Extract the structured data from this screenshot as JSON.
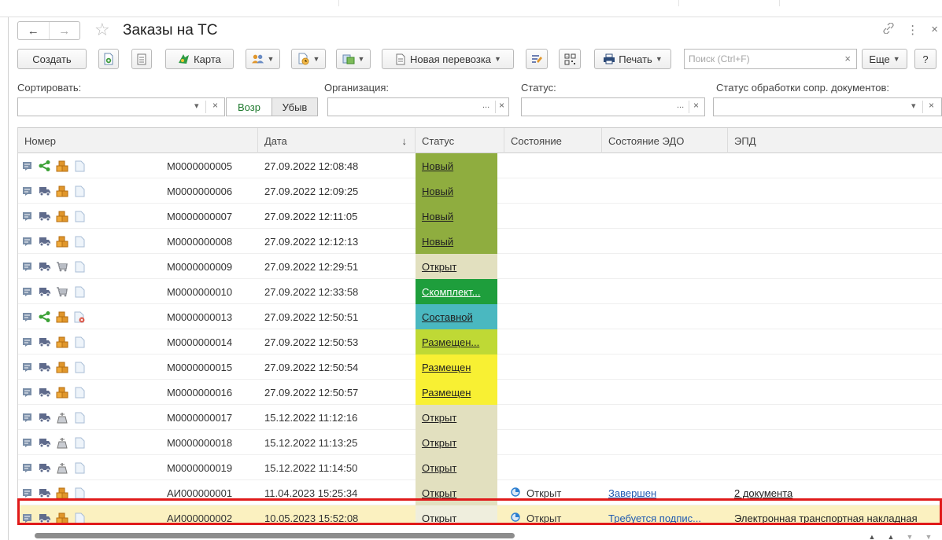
{
  "window": {
    "title": "Заказы на ТС",
    "nav_back": "←",
    "nav_forward": "→",
    "star": "☆",
    "link_icon": "🔗",
    "more_icon": "⋮",
    "close_icon": "×"
  },
  "toolbar": {
    "create": "Создать",
    "map": "Карта",
    "new_transport": "Новая перевозка",
    "print": "Печать",
    "search_placeholder": "Поиск (Ctrl+F)",
    "search_clear": "×",
    "more": "Еще",
    "help": "?"
  },
  "filters": {
    "sort_label": "Сортировать:",
    "org_label": "Организация:",
    "status_label": "Статус:",
    "doc_status_label": "Статус обработки сопр. документов:",
    "asc": "Возр",
    "desc": "Убыв",
    "dots": "...",
    "clear": "×",
    "dropdown": "▾"
  },
  "table": {
    "columns": {
      "number": "Номер",
      "date": "Дата",
      "sort_arrow": "↓",
      "status": "Статус",
      "state": "Состояние",
      "edo_state": "Состояние ЭДО",
      "epd": "ЭПД"
    },
    "rows": [
      {
        "icons": [
          "doc",
          "share",
          "box",
          "page"
        ],
        "number": "M0000000005",
        "date": "27.09.2022 12:08:48",
        "status": "Новый",
        "status_color": "#8fad3f",
        "state": "",
        "edo": "",
        "epd": ""
      },
      {
        "icons": [
          "doc",
          "truck",
          "box",
          "page"
        ],
        "number": "M0000000006",
        "date": "27.09.2022 12:09:25",
        "status": "Новый",
        "status_color": "#8fad3f",
        "state": "",
        "edo": "",
        "epd": ""
      },
      {
        "icons": [
          "doc",
          "truck",
          "box",
          "page"
        ],
        "number": "M0000000007",
        "date": "27.09.2022 12:11:05",
        "status": "Новый",
        "status_color": "#8fad3f",
        "state": "",
        "edo": "",
        "epd": ""
      },
      {
        "icons": [
          "doc",
          "truck",
          "box",
          "page"
        ],
        "number": "M0000000008",
        "date": "27.09.2022 12:12:13",
        "status": "Новый",
        "status_color": "#8fad3f",
        "state": "",
        "edo": "",
        "epd": ""
      },
      {
        "icons": [
          "doc",
          "truck",
          "cart",
          "page"
        ],
        "number": "M0000000009",
        "date": "27.09.2022 12:29:51",
        "status": "Открыт",
        "status_color": "#e2e0bf",
        "state": "",
        "edo": "",
        "epd": ""
      },
      {
        "icons": [
          "doc",
          "truck",
          "cart",
          "page"
        ],
        "number": "M0000000010",
        "date": "27.09.2022 12:33:58",
        "status": "Скомплект...",
        "status_color": "#1e9e3c",
        "state": "",
        "edo": "",
        "epd": ""
      },
      {
        "icons": [
          "doc",
          "share",
          "box",
          "page-x"
        ],
        "number": "M0000000013",
        "date": "27.09.2022 12:50:51",
        "status": "Составной",
        "status_color": "#4ab8c0",
        "state": "",
        "edo": "",
        "epd": ""
      },
      {
        "icons": [
          "doc",
          "truck",
          "box",
          "page"
        ],
        "number": "M0000000014",
        "date": "27.09.2022 12:50:53",
        "status": "Размещен...",
        "status_color": "#bfd935",
        "state": "",
        "edo": "",
        "epd": ""
      },
      {
        "icons": [
          "doc",
          "truck",
          "box",
          "page"
        ],
        "number": "M0000000015",
        "date": "27.09.2022 12:50:54",
        "status": "Размещен",
        "status_color": "#f8f033",
        "state": "",
        "edo": "",
        "epd": ""
      },
      {
        "icons": [
          "doc",
          "truck",
          "box",
          "page"
        ],
        "number": "M0000000016",
        "date": "27.09.2022 12:50:57",
        "status": "Размещен",
        "status_color": "#f8f033",
        "state": "",
        "edo": "",
        "epd": ""
      },
      {
        "icons": [
          "doc",
          "truck",
          "lift",
          "page"
        ],
        "number": "M0000000017",
        "date": "15.12.2022 11:12:16",
        "status": "Открыт",
        "status_color": "#e2e0bf",
        "state": "",
        "edo": "",
        "epd": ""
      },
      {
        "icons": [
          "doc",
          "truck",
          "lift",
          "page"
        ],
        "number": "M0000000018",
        "date": "15.12.2022 11:13:25",
        "status": "Открыт",
        "status_color": "#e2e0bf",
        "state": "",
        "edo": "",
        "epd": ""
      },
      {
        "icons": [
          "doc",
          "truck",
          "lift",
          "page"
        ],
        "number": "M0000000019",
        "date": "15.12.2022 11:14:50",
        "status": "Открыт",
        "status_color": "#e2e0bf",
        "state": "",
        "edo": "",
        "epd": ""
      },
      {
        "icons": [
          "doc",
          "truck",
          "box",
          "page"
        ],
        "number": "АИ000000001",
        "date": "11.04.2023 15:25:34",
        "status": "Открыт",
        "status_color": "#e2e0bf",
        "state": "Открыт",
        "edo": "Завершен",
        "epd": "2 документа"
      },
      {
        "icons": [
          "doc",
          "truck",
          "box",
          "page"
        ],
        "number": "АИ000000002",
        "date": "10.05.2023 15:52:08",
        "status": "Открыт",
        "status_color": "#efeedd",
        "state": "Открыт",
        "edo": "Требуется подпис...",
        "epd": "Электронная транспортная накладная",
        "selected": true
      }
    ]
  },
  "colors": {
    "selected_row": "#fbf1c0",
    "selection_border": "#e01a1a"
  }
}
